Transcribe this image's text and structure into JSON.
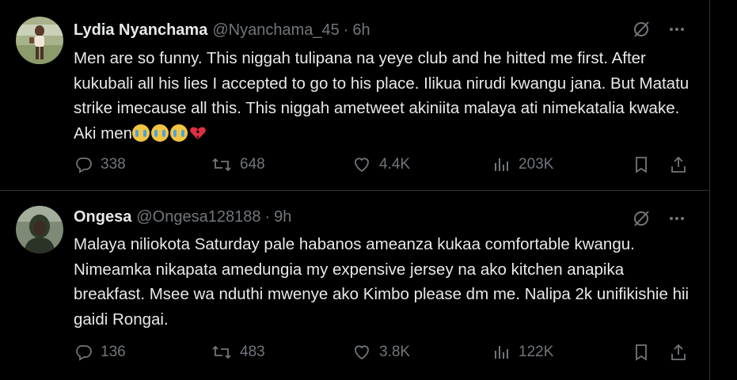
{
  "tweets": [
    {
      "name": "Lydia Nyanchama",
      "handle": "@Nyanchama_45",
      "separator": "·",
      "time": "6h",
      "text": "Men are so funny. This niggah tulipana na yeye club and he hitted me first. After kukubali all his lies I accepted to go to his place. Ilikua nirudi kwangu jana. But Matatu strike imecause all this. This niggah ametweet akiniita malaya ati nimekatalia kwake. Aki men",
      "emojis": [
        "loudly-crying-face",
        "loudly-crying-face",
        "loudly-crying-face",
        "broken-heart"
      ],
      "replies": "338",
      "reposts": "648",
      "likes": "4.4K",
      "views": "203K"
    },
    {
      "name": "Ongesa",
      "handle": "@Ongesa128188",
      "separator": "·",
      "time": "9h",
      "text": "Malaya niliokota Saturday pale habanos ameanza kukaa comfortable kwangu. Nimeamka nikapata amedungia my expensive jersey na ako kitchen anapika breakfast. Msee wa nduthi mwenye ako Kimbo please dm me. Nalipa 2k unifikishie hii gaidi Rongai.",
      "emojis": [],
      "replies": "136",
      "reposts": "483",
      "likes": "3.8K",
      "views": "122K"
    }
  ],
  "colors": {
    "background": "#000000",
    "text": "#e7e9ea",
    "muted": "#71767b",
    "divider": "#2f3336"
  },
  "icons": [
    "grok-icon",
    "more-icon",
    "reply-icon",
    "retweet-icon",
    "like-icon",
    "views-icon",
    "bookmark-icon",
    "share-icon"
  ]
}
